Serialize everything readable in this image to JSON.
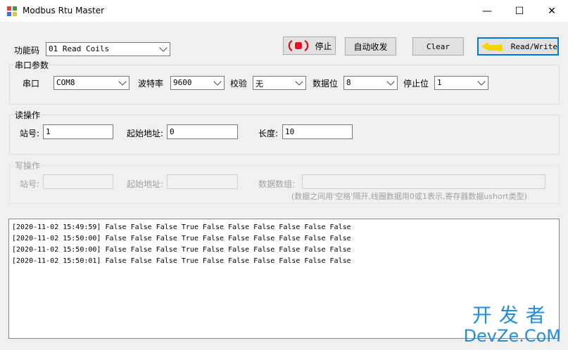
{
  "window": {
    "title": "Modbus Rtu Master",
    "minimize": "—",
    "maximize": "☐",
    "close": "✕"
  },
  "toolbar": {
    "func_label": "功能码",
    "func_value": "01 Read Coils",
    "stop_label": "停止",
    "auto_label": "自动收发",
    "clear_label": "Clear",
    "readwrite_label": "Read/Write"
  },
  "serial": {
    "legend": "串口参数",
    "port_label": "串口",
    "port_value": "COM8",
    "baud_label": "波特率",
    "baud_value": "9600",
    "parity_label": "校验",
    "parity_value": "无",
    "databits_label": "数据位",
    "databits_value": "8",
    "stopbits_label": "停止位",
    "stopbits_value": "1"
  },
  "read": {
    "legend": "读操作",
    "station_label": "站号:",
    "station_value": "1",
    "start_label": "起始地址:",
    "start_value": "0",
    "length_label": "长度:",
    "length_value": "10"
  },
  "write": {
    "legend": "写操作",
    "station_label": "站号:",
    "station_value": "",
    "start_label": "起始地址:",
    "start_value": "",
    "data_label": "数据数组:",
    "data_value": "",
    "hint": "(数据之间用'空格'隔开,线圈数据用0或1表示,寄存器数据ushort类型)"
  },
  "log": [
    "[2020-11-02 15:49:59] False False False True False False False False False False",
    "[2020-11-02 15:50:00] False False False True False False False False False False",
    "[2020-11-02 15:50:00] False False False True False False False False False False",
    "[2020-11-02 15:50:01] False False False True False False False False False False"
  ],
  "watermark": {
    "line1": "开发者",
    "line2": "DevZe.CoM"
  },
  "colors": {
    "accent": "#0078d7",
    "stop_red": "#e81123",
    "arrow_yellow": "#f5d400",
    "watermark": "#1f8ee8"
  }
}
